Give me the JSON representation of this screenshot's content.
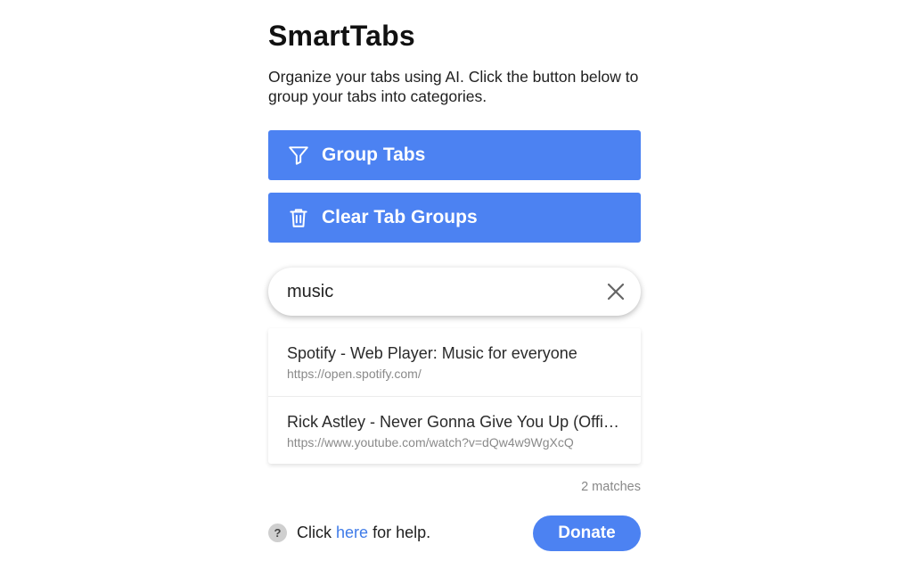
{
  "app": {
    "title": "SmartTabs",
    "description": "Organize your tabs using AI. Click the button below to group your tabs into categories."
  },
  "buttons": {
    "group": {
      "label": "Group Tabs",
      "icon": "filter-icon"
    },
    "clear": {
      "label": "Clear Tab Groups",
      "icon": "trash-icon"
    }
  },
  "search": {
    "value": "music",
    "clear_icon": "close-icon"
  },
  "results": [
    {
      "title": "Spotify - Web Player: Music for everyone",
      "url": "https://open.spotify.com/"
    },
    {
      "title": "Rick Astley - Never Gonna Give You Up (Official Music Video)",
      "url": "https://www.youtube.com/watch?v=dQw4w9WgXcQ"
    }
  ],
  "match_count": "2 matches",
  "footer": {
    "help_icon": "?",
    "help_prefix": "Click",
    "help_link": "here",
    "help_suffix": "for help.",
    "donate_label": "Donate"
  },
  "colors": {
    "accent": "#4c82f2",
    "link": "#3f7be8"
  }
}
